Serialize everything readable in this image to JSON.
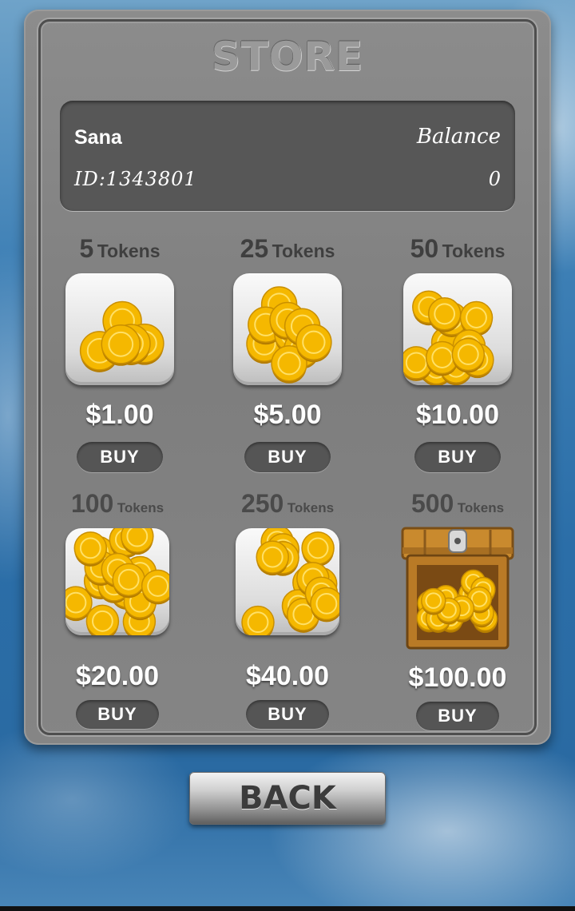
{
  "store": {
    "title": "STORE",
    "account": {
      "name": "Sana",
      "balance_label": "Balance",
      "id_text": "ID:1343801",
      "balance_value": "0"
    },
    "packages": [
      {
        "amount": "5",
        "unit": "Tokens",
        "price": "$1.00",
        "buy_label": "BUY",
        "icon": "coin-pile-small-icon"
      },
      {
        "amount": "25",
        "unit": "Tokens",
        "price": "$5.00",
        "buy_label": "BUY",
        "icon": "coin-pile-medium-icon"
      },
      {
        "amount": "50",
        "unit": "Tokens",
        "price": "$10.00",
        "buy_label": "BUY",
        "icon": "coin-pile-large-icon"
      },
      {
        "amount": "100",
        "unit": "Tokens",
        "price": "$20.00",
        "buy_label": "BUY",
        "icon": "coin-pile-xlarge-icon"
      },
      {
        "amount": "250",
        "unit": "Tokens",
        "price": "$40.00",
        "buy_label": "BUY",
        "icon": "coin-stacks-icon"
      },
      {
        "amount": "500",
        "unit": "Tokens",
        "price": "$100.00",
        "buy_label": "BUY",
        "icon": "treasure-chest-icon"
      }
    ],
    "back_label": "BACK"
  },
  "colors": {
    "coin_gold": "#f5b800",
    "coin_highlight": "#ffe066",
    "panel_gray": "#828282",
    "button_dark": "#555555"
  }
}
